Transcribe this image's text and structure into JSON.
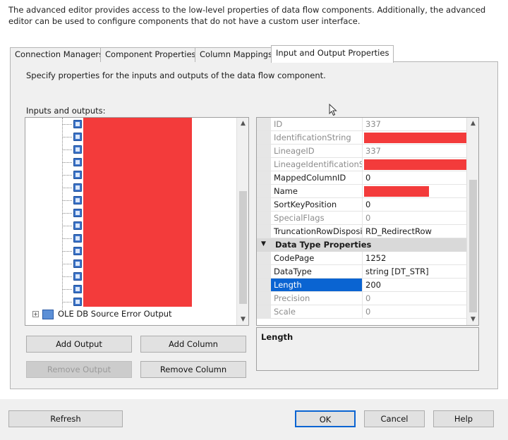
{
  "intro_text": "The advanced editor provides access to the low-level properties of data flow components. Additionally, the advanced editor can be used to configure components that do not have a custom user interface.",
  "tabs": [
    {
      "label": "Connection Managers",
      "active": false
    },
    {
      "label": "Component Properties",
      "active": false
    },
    {
      "label": "Column Mappings",
      "active": false
    },
    {
      "label": "Input and Output Properties",
      "active": true
    }
  ],
  "description": "Specify properties for the inputs and outputs of the data flow component.",
  "inputs_outputs_label": "Inputs and outputs:",
  "tree": {
    "error_output_label": "OLE DB Source Error Output",
    "column_count": 15
  },
  "buttons": {
    "add_output": "Add Output",
    "add_column": "Add Column",
    "remove_output": "Remove Output",
    "remove_column": "Remove Column",
    "refresh": "Refresh",
    "ok": "OK",
    "cancel": "Cancel",
    "help": "Help"
  },
  "properties": [
    {
      "name": "ID",
      "value": "337",
      "readonly": true
    },
    {
      "name": "IdentificationString",
      "value": "",
      "readonly": true,
      "redacted": true
    },
    {
      "name": "LineageID",
      "value": "337",
      "readonly": true
    },
    {
      "name": "LineageIdentificationSt",
      "value": "",
      "readonly": true,
      "redacted": true
    },
    {
      "name": "MappedColumnID",
      "value": "0",
      "readonly": false
    },
    {
      "name": "Name",
      "value": "",
      "readonly": false,
      "redacted": true
    },
    {
      "name": "SortKeyPosition",
      "value": "0",
      "readonly": false
    },
    {
      "name": "SpecialFlags",
      "value": "0",
      "readonly": true
    },
    {
      "name": "TruncationRowDisposit",
      "value": "RD_RedirectRow",
      "readonly": false
    }
  ],
  "category": "Data Type Properties",
  "type_properties": [
    {
      "name": "CodePage",
      "value": "1252",
      "readonly": false
    },
    {
      "name": "DataType",
      "value": "string [DT_STR]",
      "readonly": false
    },
    {
      "name": "Length",
      "value": "200",
      "readonly": false,
      "selected": true
    },
    {
      "name": "Precision",
      "value": "0",
      "readonly": true
    },
    {
      "name": "Scale",
      "value": "0",
      "readonly": true
    }
  ],
  "description_box_title": "Length"
}
